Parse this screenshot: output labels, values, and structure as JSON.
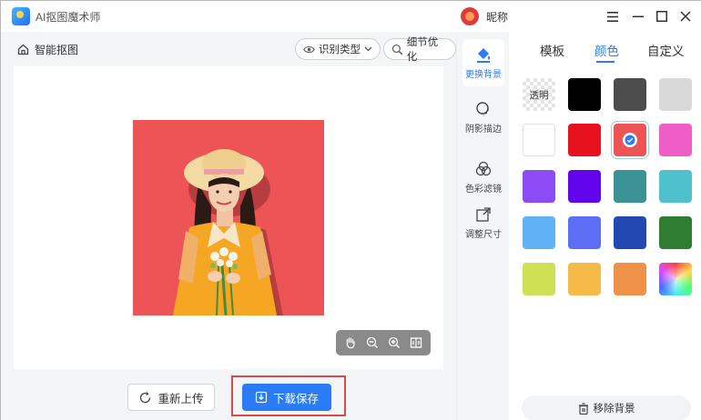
{
  "app": {
    "title": "AI抠图魔术师",
    "nickname": "昵称"
  },
  "window_controls": {
    "menu": "☰",
    "minimize": "—",
    "maximize": "□",
    "close": "✕"
  },
  "toolbar": {
    "smart_cut": "智能抠图",
    "recognize_type": "识别类型",
    "detail_optimize": "细节优化"
  },
  "actions": {
    "reupload": "重新上传",
    "download_save": "下载保存"
  },
  "tools": [
    {
      "label": "更换背景",
      "icon": "paint-bucket-icon",
      "active": true
    },
    {
      "label": "阴影描边",
      "icon": "shadow-outline-icon",
      "active": false
    },
    {
      "label": "色彩滤镜",
      "icon": "color-filter-icon",
      "active": false
    },
    {
      "label": "调整尺寸",
      "icon": "resize-icon",
      "active": false
    }
  ],
  "tabs": [
    {
      "label": "模板",
      "active": false
    },
    {
      "label": "颜色",
      "active": true
    },
    {
      "label": "自定义",
      "active": false
    }
  ],
  "colors": {
    "transparent_label": "透明",
    "swatches": [
      "transparent",
      "#000000",
      "#4d4d4d",
      "#d9d9d9",
      "#ffffff",
      "#e8121e",
      "#ec5456",
      "#ef5ec6",
      "#8d4bf5",
      "#6205ec",
      "#3a9196",
      "#4fc1cc",
      "#5fb2f6",
      "#5b6ef5",
      "#2348b2",
      "#2e7d32",
      "#cfe054",
      "#f6ba49",
      "#ef9248",
      "rainbow"
    ],
    "selected_index": 6
  },
  "remove_bg_label": "移除背景",
  "photo": {
    "background_color": "#ec5456"
  },
  "accent_color": "#2a7cf6"
}
